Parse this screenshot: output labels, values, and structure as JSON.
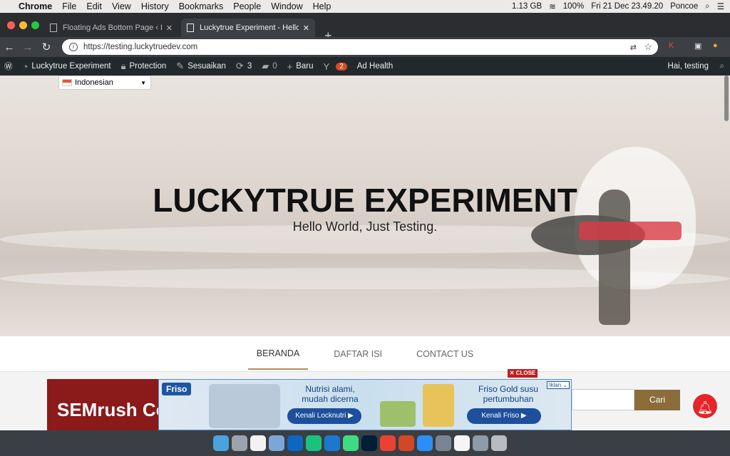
{
  "menubar": {
    "app": "Chrome",
    "items": [
      "File",
      "Edit",
      "View",
      "History",
      "Bookmarks",
      "People",
      "Window",
      "Help"
    ],
    "memory": "1.13 GB",
    "battery": "100%",
    "datetime": "Fri 21 Dec  23.49.20",
    "user": "Poncoe"
  },
  "tabs": [
    {
      "label": "Floating Ads Bottom Page ‹ Lu"
    },
    {
      "label": "Luckytrue Experiment - Hello W"
    }
  ],
  "omnibox": {
    "url": "https://testing.luckytruedev.com"
  },
  "wpbar": {
    "site": "Luckytrue Experiment",
    "protection": "Protection",
    "customize": "Sesuaikan",
    "updates": "3",
    "comments": "0",
    "new": "Baru",
    "yoast_count": "2",
    "ad_health": "Ad Health",
    "greeting": "Hai, testing"
  },
  "lang": {
    "label": "Indonesian"
  },
  "hero": {
    "title": "LUCKYTRUE EXPERIMENT",
    "subtitle": "Hello World, Just Testing."
  },
  "nav": {
    "items": [
      "BERANDA",
      "DAFTAR ISI",
      "CONTACT US"
    ]
  },
  "content": {
    "sidebar_ad": "SEMrush Co",
    "search_button": "Cari"
  },
  "ad": {
    "close": "✕ CLOSE",
    "brand": "Friso",
    "tagline1": "Nutrisi alami, mudah dicerna",
    "button1": "Kenali Locknutri ▶",
    "tagline2": "Friso Gold susu pertumbuhan",
    "button2": "Kenali Friso ▶",
    "iklan": "Iklan ⌄"
  }
}
